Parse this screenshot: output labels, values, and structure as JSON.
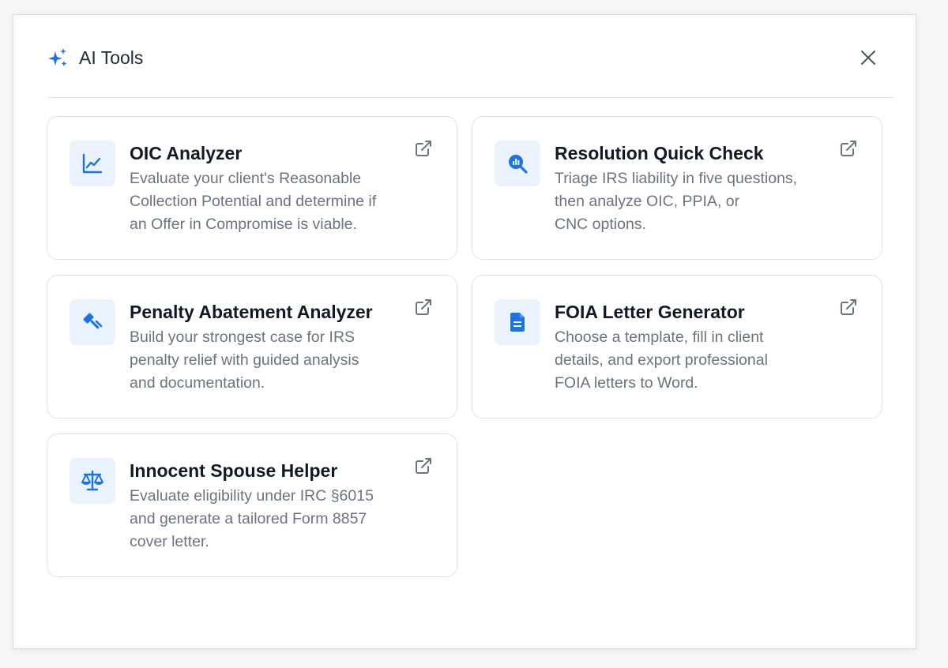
{
  "dialog": {
    "title": "AI Tools",
    "header_icon": "sparkles-icon",
    "close_icon": "close-icon"
  },
  "colors": {
    "accent": "#1a73e8",
    "icon_bg": "#eaf2fe",
    "title_text": "#111827",
    "desc_text": "#6b7280",
    "border": "#dfe3e8"
  },
  "tools": [
    {
      "title": "OIC Analyzer",
      "icon": "line-chart-icon",
      "desc": [
        "Evaluate your client's Reasonable",
        "Collection Potential and determine if",
        "an Offer in Compromise is viable."
      ]
    },
    {
      "title": "Resolution Quick Check",
      "icon": "search-chart-icon",
      "desc": [
        "Triage IRS liability in five questions,",
        "then analyze OIC, PPIA, or",
        "CNC options."
      ]
    },
    {
      "title": "Penalty Abatement Analyzer",
      "icon": "gavel-icon",
      "desc": [
        "Build your strongest case for IRS",
        "penalty relief with guided analysis",
        "and documentation."
      ]
    },
    {
      "title": "FOIA Letter Generator",
      "icon": "document-icon",
      "desc": [
        "Choose a template, fill in client",
        "details, and export professional",
        "FOIA letters to Word."
      ]
    },
    {
      "title": "Innocent Spouse Helper",
      "icon": "scale-icon",
      "desc": [
        "Evaluate eligibility under IRC §6015",
        "and generate a tailored Form 8857",
        "cover letter."
      ]
    }
  ]
}
